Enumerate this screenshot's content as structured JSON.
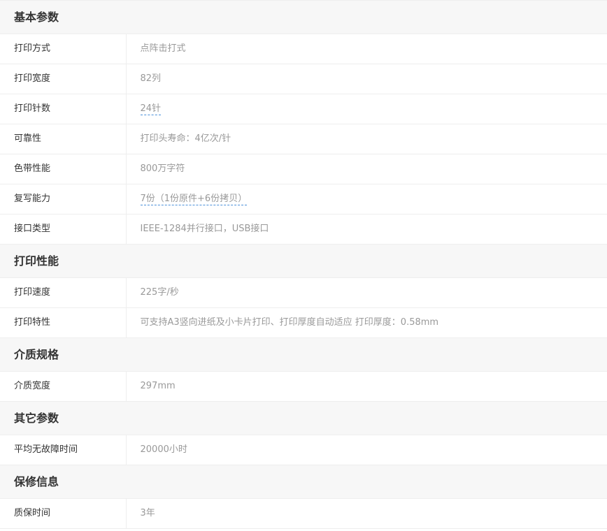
{
  "sections": [
    {
      "title": "基本参数",
      "items": [
        {
          "name": "打印方式",
          "value": "点阵击打式",
          "tip": false
        },
        {
          "name": "打印宽度",
          "value": "82列",
          "tip": false
        },
        {
          "name": "打印针数",
          "value": "24针",
          "tip": true
        },
        {
          "name": "可靠性",
          "value": "打印头寿命：4亿次/针",
          "tip": false
        },
        {
          "name": "色带性能",
          "value": "800万字符",
          "tip": false
        },
        {
          "name": "复写能力",
          "value": "7份（1份原件+6份拷贝）",
          "tip": true
        },
        {
          "name": "接口类型",
          "value": "IEEE-1284并行接口，USB接口",
          "tip": false
        }
      ]
    },
    {
      "title": "打印性能",
      "items": [
        {
          "name": "打印速度",
          "value": "225字/秒",
          "tip": false
        },
        {
          "name": "打印特性",
          "value": "可支持A3竖向进纸及小卡片打印、打印厚度自动适应 打印厚度：0.58mm",
          "tip": false
        }
      ]
    },
    {
      "title": "介质规格",
      "items": [
        {
          "name": "介质宽度",
          "value": "297mm",
          "tip": false
        }
      ]
    },
    {
      "title": "其它参数",
      "items": [
        {
          "name": "平均无故障时间",
          "value": "20000小时",
          "tip": false
        }
      ]
    },
    {
      "title": "保修信息",
      "items": [
        {
          "name": "质保时间",
          "value": "3年",
          "tip": false
        }
      ]
    }
  ],
  "colors": {
    "section_bg": "#f7f7f7",
    "border": "#eeeeee",
    "label": "#333333",
    "value": "#999999",
    "tip_underline": "#4a90d9"
  }
}
